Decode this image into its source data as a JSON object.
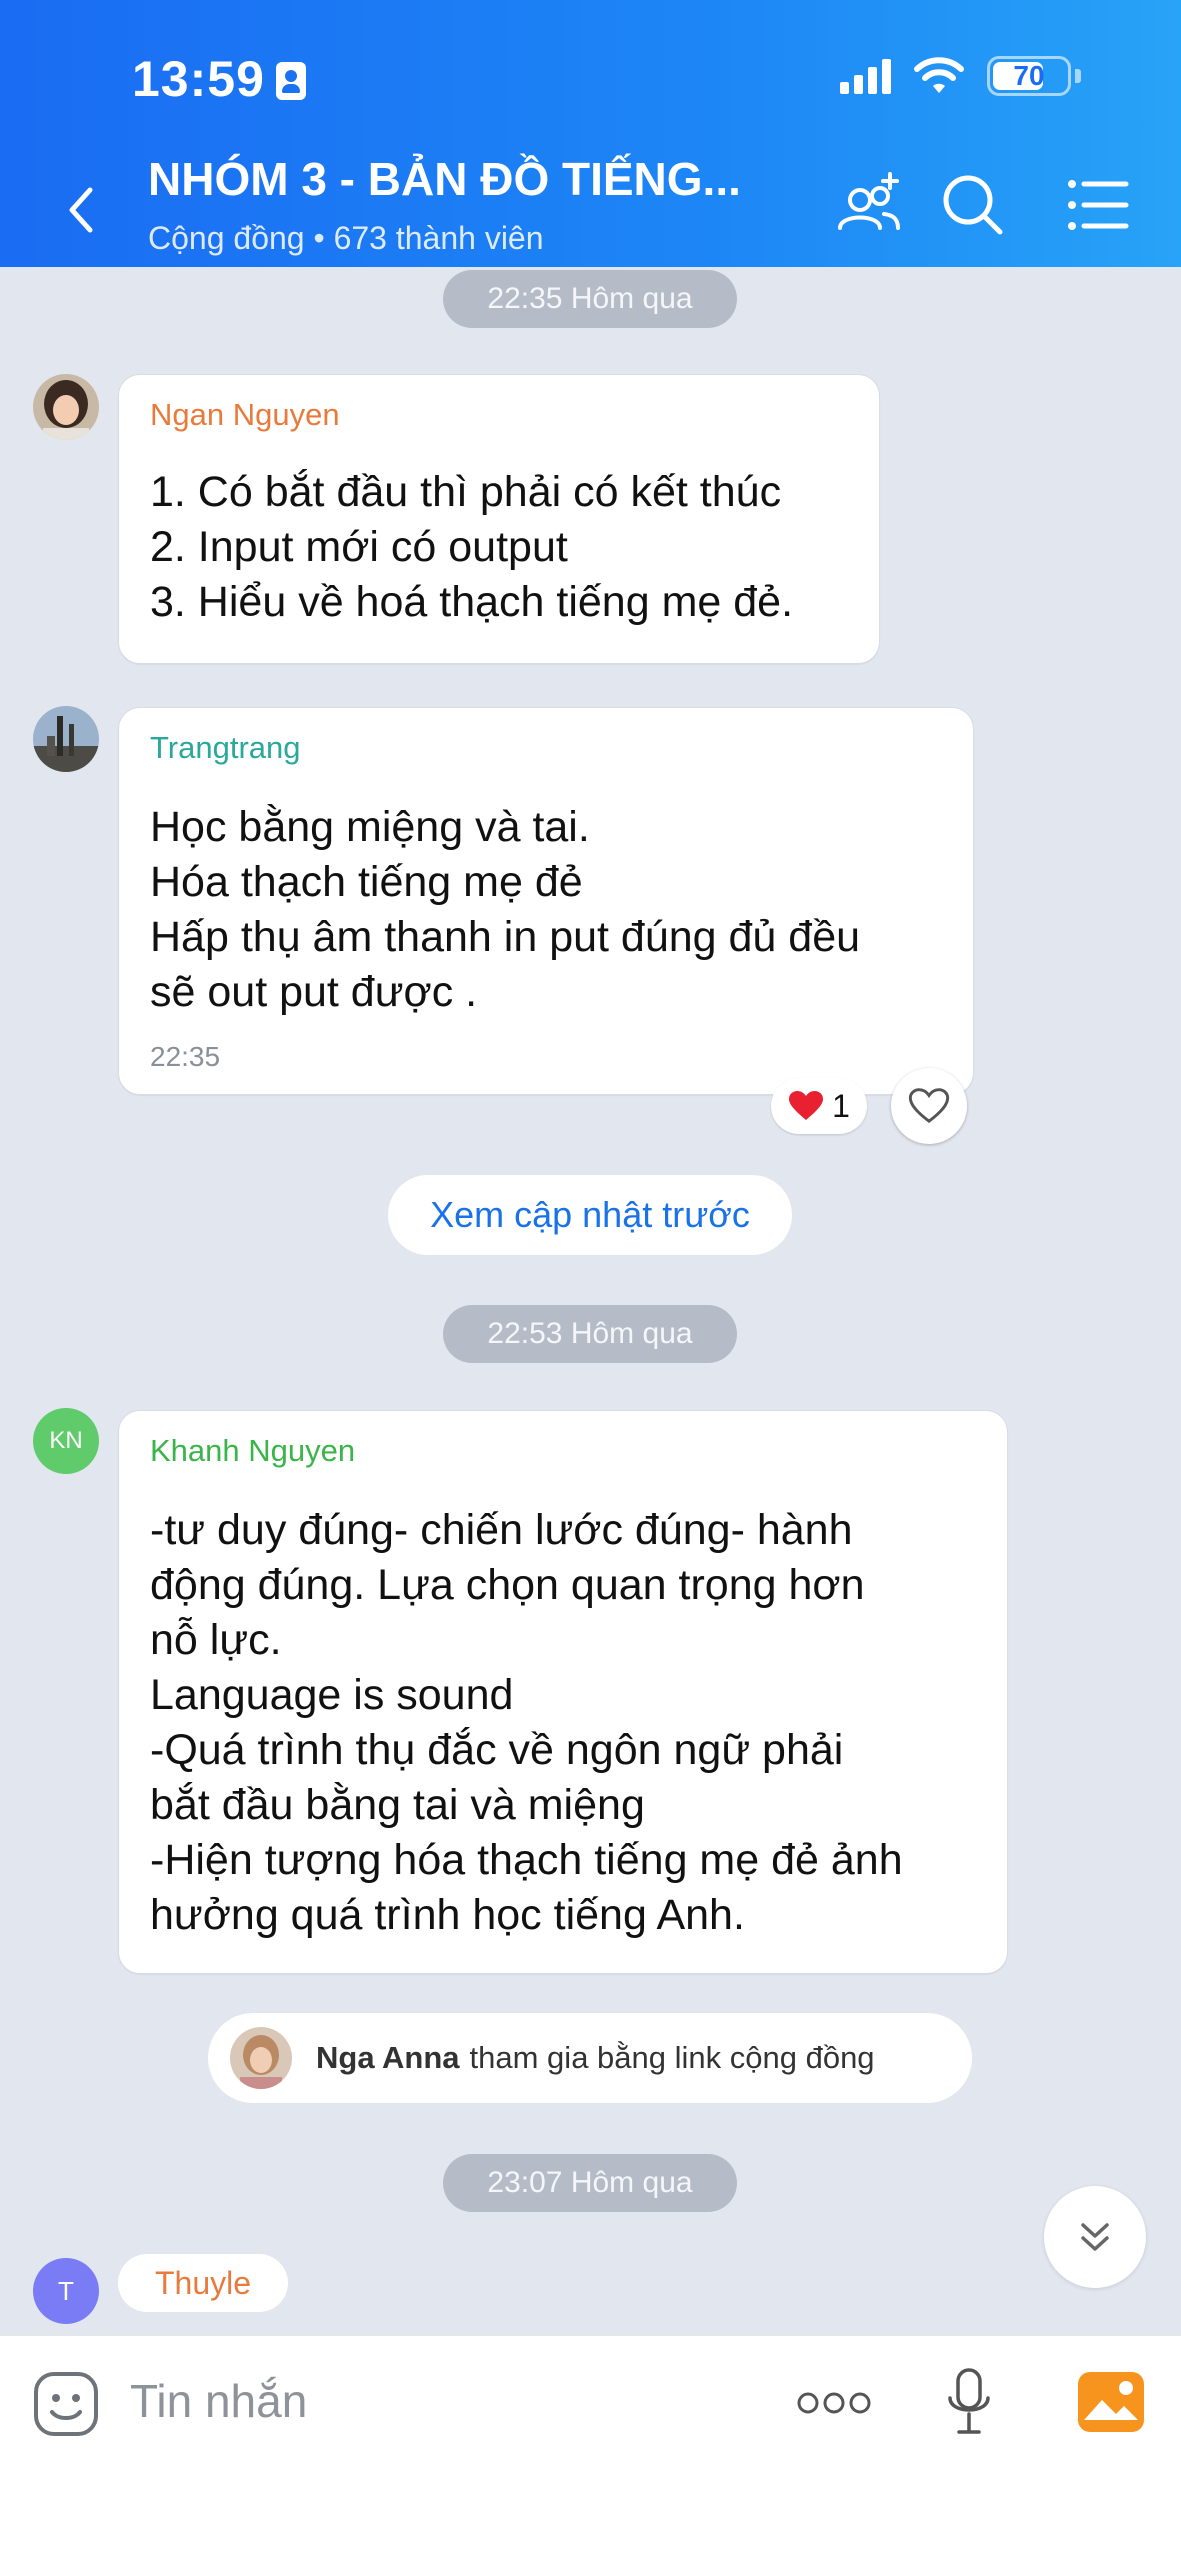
{
  "status_bar": {
    "time": "13:59",
    "battery": "70"
  },
  "header": {
    "title": "NHÓM 3 - BẢN ĐỒ TIẾNG...",
    "subtitle": "Cộng đồng • 673 thành viên"
  },
  "messages": {
    "time_1": "22:35 Hôm qua",
    "msg1": {
      "sender": "Ngan Nguyen",
      "lines": [
        "1. Có bắt đầu thì phải có kết thúc",
        "2. Input mới có output",
        "3. Hiểu về hoá thạch tiếng mẹ đẻ."
      ]
    },
    "msg2": {
      "sender": "Trangtrang",
      "lines": [
        "Học bằng miệng và tai.",
        "Hóa thạch tiếng mẹ đẻ",
        "Hấp thụ âm thanh in put đúng đủ đều",
        "sẽ out put được ."
      ],
      "time": "22:35",
      "reaction_count": "1"
    },
    "load_previous": "Xem cập nhật trước",
    "time_2": "22:53 Hôm qua",
    "msg3": {
      "avatar_initials": "KN",
      "sender": "Khanh Nguyen",
      "lines": [
        "-tư duy đúng- chiến lước đúng- hành",
        "động đúng. Lựa chọn quan trọng hơn",
        "nỗ lực.",
        "Language is sound",
        "-Quá trình thụ đắc về ngôn ngữ phải",
        "bắt đầu bằng tai và miệng",
        "-Hiện tượng hóa thạch tiếng mẹ đẻ ảnh",
        "hưởng quá trình học tiếng Anh."
      ]
    },
    "join_notice": {
      "name": "Nga Anna",
      "text": "tham gia bằng link cộng đồng"
    },
    "time_3": "23:07 Hôm qua",
    "msg4": {
      "avatar_initials": "T",
      "sender": "Thuyle"
    }
  },
  "composer": {
    "placeholder": "Tin nhắn"
  },
  "colors": {
    "header_start": "#1a6cf2",
    "header_end": "#27a3f7",
    "ngan_name": "#e87b3c",
    "trang_name": "#2aa89a",
    "khanh_name": "#3bb54a",
    "link_blue": "#1a72e8"
  }
}
